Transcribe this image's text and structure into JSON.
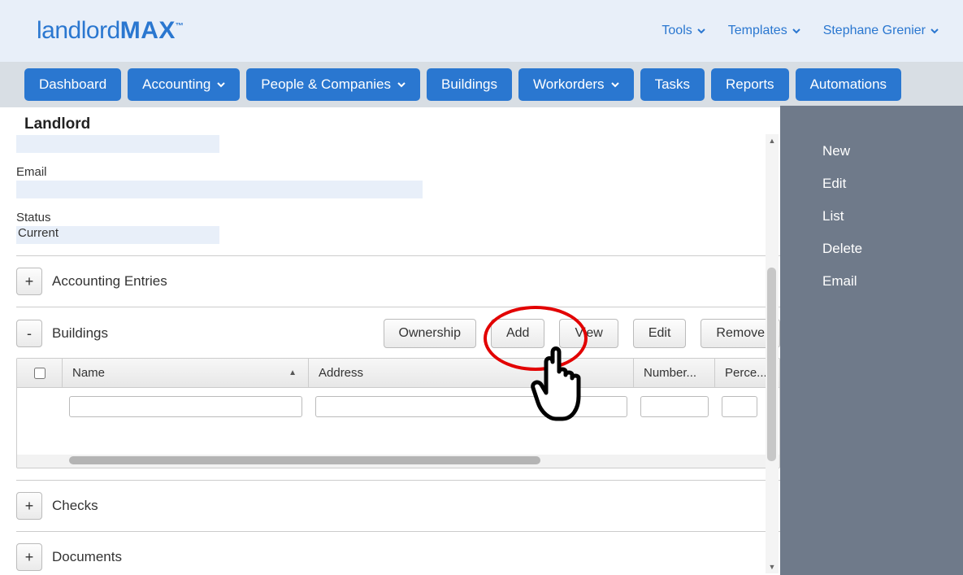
{
  "top": {
    "logo_prefix": "landlord",
    "logo_suffix": "MAX",
    "logo_tm": "™",
    "menu": {
      "tools": "Tools",
      "templates": "Templates",
      "user": "Stephane Grenier"
    }
  },
  "nav": {
    "dashboard": "Dashboard",
    "accounting": "Accounting",
    "people": "People & Companies",
    "buildings": "Buildings",
    "workorders": "Workorders",
    "tasks": "Tasks",
    "reports": "Reports",
    "automations": "Automations"
  },
  "page_title": "Landlord",
  "fields": {
    "email_label": "Email",
    "email_value": "",
    "status_label": "Status",
    "status_value": "Current"
  },
  "sections": {
    "accounting_entries": "Accounting Entries",
    "buildings": "Buildings",
    "checks": "Checks",
    "documents": "Documents"
  },
  "buildings_buttons": {
    "ownership": "Ownership",
    "add": "Add",
    "view": "View",
    "edit": "Edit",
    "remove": "Remove"
  },
  "table": {
    "col_name": "Name",
    "col_address": "Address",
    "col_number": "Number...",
    "col_perc": "Perce..."
  },
  "sidebar": {
    "new": "New",
    "edit": "Edit",
    "list": "List",
    "delete": "Delete",
    "email": "Email"
  },
  "toggle": {
    "plus": "+",
    "minus": "-"
  },
  "sort_arrow": "▲"
}
